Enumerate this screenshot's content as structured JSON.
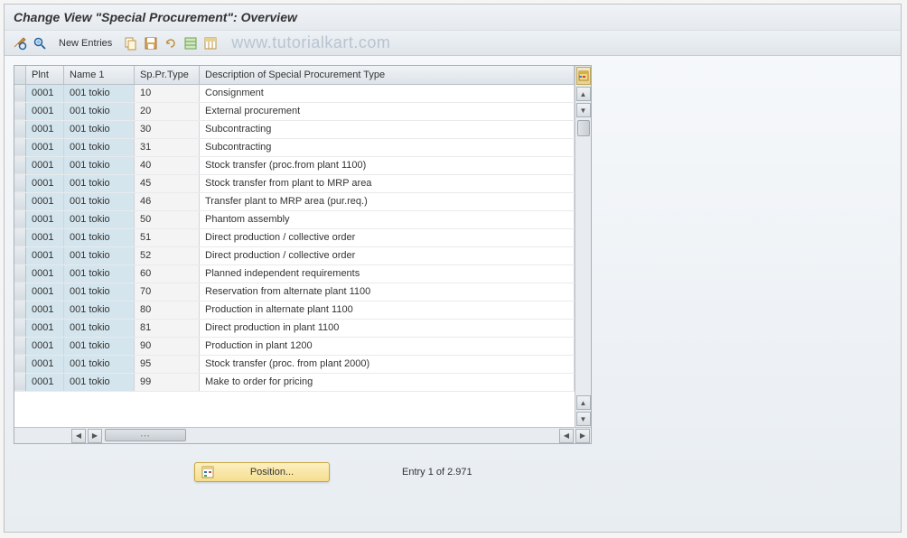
{
  "title": "Change View \"Special Procurement\": Overview",
  "toolbar": {
    "new_entries": "New Entries"
  },
  "watermark": "www.tutorialkart.com",
  "table": {
    "columns": {
      "plnt": "Plnt",
      "name": "Name 1",
      "type": "Sp.Pr.Type",
      "desc": "Description of Special Procurement Type"
    },
    "rows": [
      {
        "plnt": "0001",
        "name": "001 tokio",
        "type": "10",
        "desc": "Consignment"
      },
      {
        "plnt": "0001",
        "name": "001 tokio",
        "type": "20",
        "desc": "External procurement"
      },
      {
        "plnt": "0001",
        "name": "001 tokio",
        "type": "30",
        "desc": "Subcontracting"
      },
      {
        "plnt": "0001",
        "name": "001 tokio",
        "type": "31",
        "desc": "Subcontracting"
      },
      {
        "plnt": "0001",
        "name": "001 tokio",
        "type": "40",
        "desc": "Stock transfer (proc.from plant 1100)"
      },
      {
        "plnt": "0001",
        "name": "001 tokio",
        "type": "45",
        "desc": "Stock transfer from plant to MRP area"
      },
      {
        "plnt": "0001",
        "name": "001 tokio",
        "type": "46",
        "desc": "Transfer plant to MRP area (pur.req.)"
      },
      {
        "plnt": "0001",
        "name": "001 tokio",
        "type": "50",
        "desc": "Phantom assembly"
      },
      {
        "plnt": "0001",
        "name": "001 tokio",
        "type": "51",
        "desc": "Direct production / collective order"
      },
      {
        "plnt": "0001",
        "name": "001 tokio",
        "type": "52",
        "desc": "Direct production / collective order"
      },
      {
        "plnt": "0001",
        "name": "001 tokio",
        "type": "60",
        "desc": "Planned independent requirements"
      },
      {
        "plnt": "0001",
        "name": "001 tokio",
        "type": "70",
        "desc": "Reservation from alternate plant 1100"
      },
      {
        "plnt": "0001",
        "name": "001 tokio",
        "type": "80",
        "desc": "Production in alternate plant 1100"
      },
      {
        "plnt": "0001",
        "name": "001 tokio",
        "type": "81",
        "desc": "Direct production in plant 1100"
      },
      {
        "plnt": "0001",
        "name": "001 tokio",
        "type": "90",
        "desc": "Production in plant 1200"
      },
      {
        "plnt": "0001",
        "name": "001 tokio",
        "type": "95",
        "desc": "Stock transfer (proc. from plant 2000)"
      },
      {
        "plnt": "0001",
        "name": "001 tokio",
        "type": "99",
        "desc": "Make to order for pricing"
      }
    ]
  },
  "footer": {
    "position_label": "Position...",
    "entry_text": "Entry 1 of 2.971"
  }
}
